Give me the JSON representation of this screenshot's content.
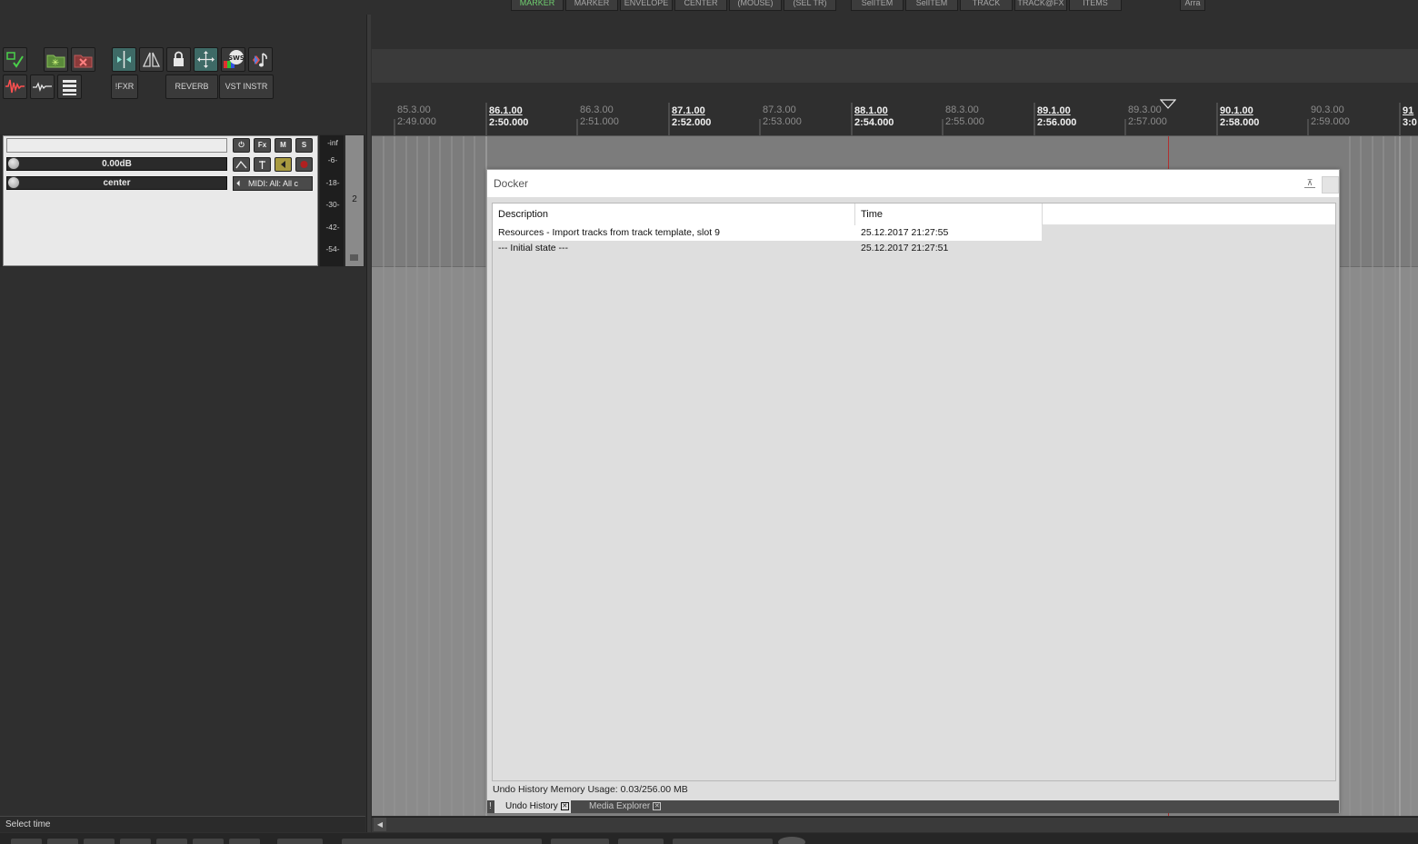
{
  "top_toolbar": {
    "buttons": [
      "MARKER",
      "MARKER",
      "ENVELOPE",
      "CENTER",
      "(MOUSE)",
      "(SEL TR)",
      "SelITEM",
      "SelITEM",
      "TRACK",
      "TRACK@FX",
      "ITEMS",
      "Arra"
    ]
  },
  "left_toolbar": {
    "icons": [
      "select-check-icon",
      "new-project-icon",
      "close-project-icon",
      "split-icon",
      "mirror-icon",
      "lock-icon",
      "move-icon",
      "sws-icon",
      "note-icon",
      "waveform-red-icon",
      "waveform-icon",
      "mixer-icon"
    ],
    "sws_label": "SWS",
    "fxr_label": "!FXR",
    "reverb_label": "REVERB",
    "vst_instr_label": "VST INSTR"
  },
  "track": {
    "name": "",
    "volume": "0.00dB",
    "pan": "center",
    "midi_input": "MIDI: All: All c",
    "buttons": {
      "power": "⏻",
      "fx": "Fx",
      "mute": "M",
      "solo": "S"
    },
    "meter_labels": [
      "-inf",
      "-6-",
      "-18-",
      "-30-",
      "-42-",
      "-54-"
    ],
    "track_number": "2"
  },
  "ruler": {
    "marks": [
      {
        "beat": "85.3.00",
        "time": "2:49.000",
        "major": false
      },
      {
        "beat": "86.1.00",
        "time": "2:50.000",
        "major": true
      },
      {
        "beat": "86.3.00",
        "time": "2:51.000",
        "major": false
      },
      {
        "beat": "87.1.00",
        "time": "2:52.000",
        "major": true
      },
      {
        "beat": "87.3.00",
        "time": "2:53.000",
        "major": false
      },
      {
        "beat": "88.1.00",
        "time": "2:54.000",
        "major": true
      },
      {
        "beat": "88.3.00",
        "time": "2:55.000",
        "major": false
      },
      {
        "beat": "89.1.00",
        "time": "2:56.000",
        "major": true
      },
      {
        "beat": "89.3.00",
        "time": "2:57.000",
        "major": false
      },
      {
        "beat": "90.1.00",
        "time": "2:58.000",
        "major": true
      },
      {
        "beat": "90.3.00",
        "time": "2:59.000",
        "major": false
      },
      {
        "beat": "91",
        "time": "3:0",
        "major": true
      }
    ]
  },
  "docker": {
    "title": "Docker",
    "columns": {
      "description": "Description",
      "time": "Time"
    },
    "rows": [
      {
        "description": "Resources - Import tracks from track template, slot 9",
        "time": "25.12.2017 21:27:55"
      },
      {
        "description": "--- Initial state ---",
        "time": "25.12.2017 21:27:51"
      }
    ],
    "memory_usage": "Undo History Memory Usage: 0.03/256.00 MB",
    "tabs": [
      {
        "label": "Undo History",
        "active": true
      },
      {
        "label": "Media Explorer",
        "active": false
      }
    ],
    "tab_indicator": "!"
  },
  "status": {
    "text": "Select time"
  },
  "colors": {
    "accent_green": "#6fd06f",
    "playhead": "#b03030",
    "docker_bg": "#dedede"
  }
}
